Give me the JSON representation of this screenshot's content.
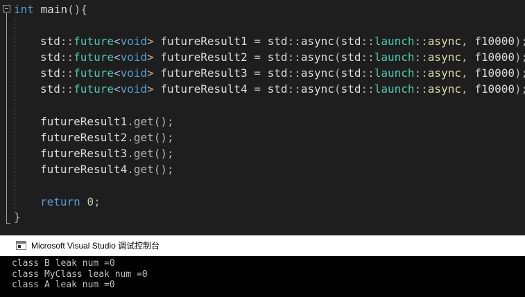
{
  "editor": {
    "signature": {
      "type": "int",
      "name": "main",
      "parens": "()",
      "brace": "{"
    },
    "futures": [
      {
        "ns": "std",
        "sep": "::",
        "template": "future",
        "lt": "<",
        "targ": "void",
        "gt": ">",
        "var": "futureResult1",
        "eq": "=",
        "ns2": "std",
        "func": "async",
        "open": "(",
        "ns3": "std",
        "launch": "launch",
        "policy": "async",
        "comma": ",",
        "callee": "f10000",
        "close": ");"
      },
      {
        "ns": "std",
        "sep": "::",
        "template": "future",
        "lt": "<",
        "targ": "void",
        "gt": ">",
        "var": "futureResult2",
        "eq": "=",
        "ns2": "std",
        "func": "async",
        "open": "(",
        "ns3": "std",
        "launch": "launch",
        "policy": "async",
        "comma": ",",
        "callee": "f10000",
        "close": ");"
      },
      {
        "ns": "std",
        "sep": "::",
        "template": "future",
        "lt": "<",
        "targ": "void",
        "gt": ">",
        "var": "futureResult3",
        "eq": "=",
        "ns2": "std",
        "func": "async",
        "open": "(",
        "ns3": "std",
        "launch": "launch",
        "policy": "async",
        "comma": ",",
        "callee": "f10000",
        "close": ");"
      },
      {
        "ns": "std",
        "sep": "::",
        "template": "future",
        "lt": "<",
        "targ": "void",
        "gt": ">",
        "var": "futureResult4",
        "eq": "=",
        "ns2": "std",
        "func": "async",
        "open": "(",
        "ns3": "std",
        "launch": "launch",
        "policy": "async",
        "comma": ",",
        "callee": "f10000",
        "close": ");"
      }
    ],
    "gets": [
      {
        "var": "futureResult1",
        "call": ".get();"
      },
      {
        "var": "futureResult2",
        "call": ".get();"
      },
      {
        "var": "futureResult3",
        "call": ".get();"
      },
      {
        "var": "futureResult4",
        "call": ".get();"
      }
    ],
    "return_stmt": {
      "keyword": "return",
      "value": "0",
      "end": ";"
    },
    "closing_brace": "}"
  },
  "console": {
    "title": "Microsoft Visual Studio 调试控制台",
    "lines": [
      "class B leak num =0",
      "class MyClass leak num =0",
      "class A leak num =0"
    ]
  },
  "colors": {
    "editor_bg": "#1e1e1e",
    "keyword": "#569cd6",
    "type": "#4ec9b0",
    "plain": "#dcdcdc",
    "number": "#b5cea8",
    "console_bg": "#000000",
    "console_text": "#c0c0c0"
  },
  "icons": {
    "fold": "collapse-minus-icon",
    "console": "console-window-icon"
  }
}
